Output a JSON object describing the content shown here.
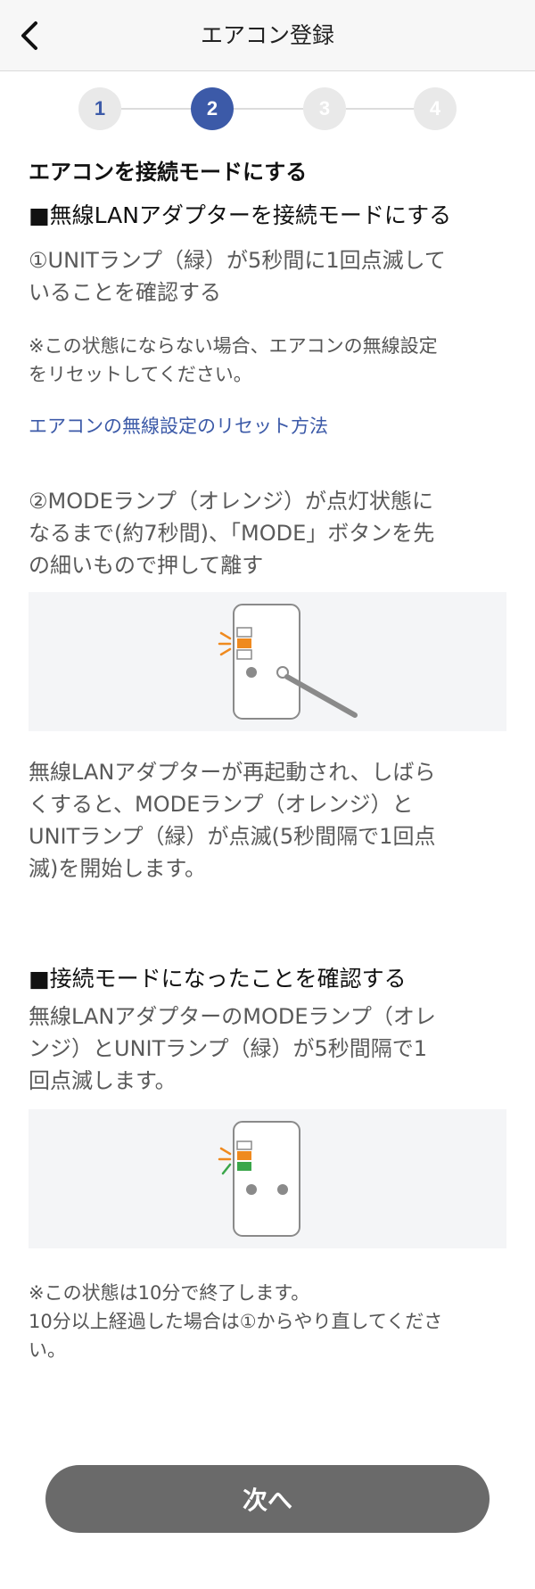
{
  "header": {
    "title": "エアコン登録",
    "back_icon": "chevron-left-icon"
  },
  "stepper": {
    "steps": [
      "1",
      "2",
      "3",
      "4"
    ],
    "current": 2
  },
  "section_title": "エアコンを接続モードにする",
  "part1": {
    "heading": "■無線LANアダプターを接続モードにする",
    "step1_line1": "①UNITランプ（緑）が5秒間に1回点滅して",
    "step1_line2": "いることを確認する",
    "note_line1": "※この状態にならない場合、エアコンの無線設定",
    "note_line2": "をリセットしてください。",
    "reset_link": "エアコンの無線設定のリセット方法",
    "step2_line1": "②MODEランプ（オレンジ）が点灯状態に",
    "step2_line2": "なるまで(約7秒間)、「MODE」ボタンを先",
    "step2_line3": "の細いもので押して離す",
    "result_line1": "無線LANアダプターが再起動され、しばら",
    "result_line2": "くすると、MODEランプ（オレンジ）と",
    "result_line3": "UNITランプ（緑）が点滅(5秒間隔で1回点",
    "result_line4": "滅)を開始します。"
  },
  "part2": {
    "heading": "■接続モードになったことを確認する",
    "text_line1": "無線LANアダプターのMODEランプ（オレ",
    "text_line2": "ンジ）とUNITランプ（緑）が5秒間隔で1",
    "text_line3": "回点滅します。",
    "note_line1": "※この状態は10分で終了します。",
    "note_line2": "10分以上経過した場合は①からやり直してくださ",
    "note_line3": "い。"
  },
  "colors": {
    "accent": "#3c5aa8",
    "orange": "#ef8a1f",
    "green": "#3aa64a",
    "button": "#6a6a6a"
  },
  "next_button": "次へ"
}
